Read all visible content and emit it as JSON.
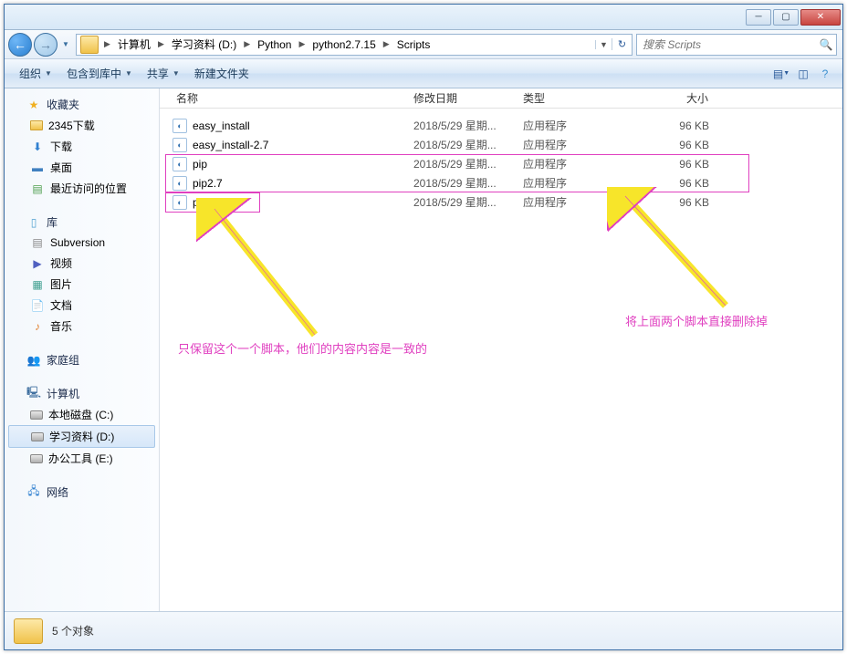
{
  "breadcrumb": {
    "items": [
      "计算机",
      "学习资料 (D:)",
      "Python",
      "python2.7.15",
      "Scripts"
    ]
  },
  "search": {
    "placeholder": "搜索 Scripts"
  },
  "toolbar": {
    "organize": "组织",
    "include": "包含到库中",
    "share": "共享",
    "newfolder": "新建文件夹"
  },
  "columns": {
    "name": "名称",
    "date": "修改日期",
    "type": "类型",
    "size": "大小"
  },
  "sidebar": {
    "favorites": "收藏夹",
    "fav_items": [
      "2345下载",
      "下载",
      "桌面",
      "最近访问的位置"
    ],
    "libraries": "库",
    "lib_items": [
      "Subversion",
      "视频",
      "图片",
      "文档",
      "音乐"
    ],
    "homegroup": "家庭组",
    "computer": "计算机",
    "drives": [
      "本地磁盘 (C:)",
      "学习资料 (D:)",
      "办公工具 (E:)"
    ],
    "network": "网络"
  },
  "files": [
    {
      "name": "easy_install",
      "date": "2018/5/29 星期...",
      "type": "应用程序",
      "size": "96 KB"
    },
    {
      "name": "easy_install-2.7",
      "date": "2018/5/29 星期...",
      "type": "应用程序",
      "size": "96 KB"
    },
    {
      "name": "pip",
      "date": "2018/5/29 星期...",
      "type": "应用程序",
      "size": "96 KB"
    },
    {
      "name": "pip2.7",
      "date": "2018/5/29 星期...",
      "type": "应用程序",
      "size": "96 KB"
    },
    {
      "name": "pip2",
      "date": "2018/5/29 星期...",
      "type": "应用程序",
      "size": "96 KB"
    }
  ],
  "status": {
    "count": "5 个对象"
  },
  "annotations": {
    "left": "只保留这个一个脚本，他们的内容内容是一致的",
    "right": "将上面两个脚本直接删除掉"
  }
}
